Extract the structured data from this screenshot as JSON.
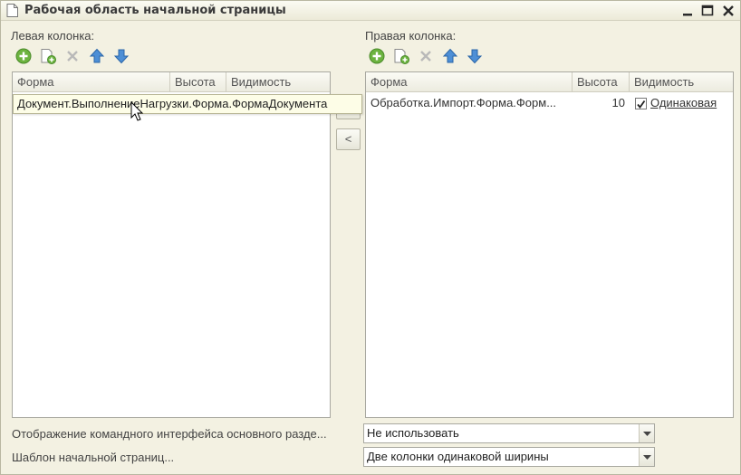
{
  "window": {
    "title": "Рабочая область начальной страницы",
    "minimize": "▁",
    "maximize": "□",
    "close": "✕"
  },
  "left": {
    "label": "Левая колонка:",
    "columns": [
      "Форма",
      "Высота",
      "Видимость"
    ],
    "rows": [],
    "tooltip": "Документ.ВыполнениеНагрузки.Форма.ФормаДокумента"
  },
  "right": {
    "label": "Правая колонка:",
    "columns": [
      "Форма",
      "Высота",
      "Видимость"
    ],
    "rows": [
      {
        "form": "Обработка.Импорт.Форма.Форм...",
        "height": "10",
        "visible": true,
        "visibility": "Одинаковая"
      }
    ]
  },
  "move": {
    "to_left": "<"
  },
  "settings": {
    "cmd_interface_label": "Отображение командного интерфейса основного разде...",
    "cmd_interface_value": "Не использовать",
    "template_label": "Шаблон начальной страниц...",
    "template_value": "Две колонки одинаковой ширины"
  },
  "icons": {
    "add": "add-icon",
    "copy": "copy-icon",
    "delete": "delete-icon",
    "up": "move-up-icon",
    "down": "move-down-icon"
  }
}
